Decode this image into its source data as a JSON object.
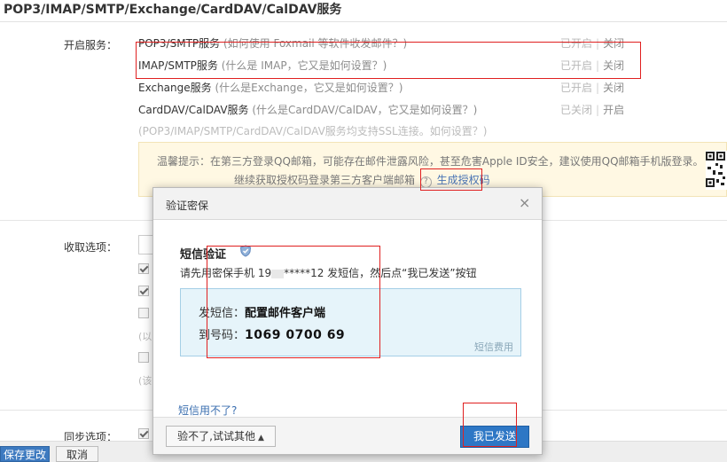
{
  "page": {
    "title": "POP3/IMAP/SMTP/Exchange/CardDAV/CalDAV服务"
  },
  "services": {
    "label": "开启服务：",
    "rows": [
      {
        "name": "POP3/SMTP服务",
        "hint": "(如何使用 Foxmail 等软件收发邮件？)",
        "status": "已开启",
        "action": "关闭"
      },
      {
        "name": "IMAP/SMTP服务",
        "hint": "(什么是 IMAP，它又是如何设置？)",
        "status": "已开启",
        "action": "关闭"
      },
      {
        "name": "Exchange服务",
        "hint": "(什么是Exchange，它又是如何设置？)",
        "status": "已开启",
        "action": "关闭"
      },
      {
        "name": "CardDAV/CalDAV服务",
        "hint": "(什么是CardDAV/CalDAV，它又是如何设置？)",
        "status": "已关闭",
        "action": "开启"
      }
    ],
    "separator": "|",
    "ssl_note": "(POP3/IMAP/SMTP/CardDAV/CalDAV服务均支持SSL连接。如何设置？)"
  },
  "tip": {
    "line1": "温馨提示：在第三方登录QQ邮箱，可能存在邮件泄露风险，甚至危害Apple ID安全，建议使用QQ邮箱手机版登录。",
    "line2": "继续获取授权码登录第三方客户端邮箱",
    "help": "?",
    "generate_code": "生成授权码"
  },
  "receive": {
    "label": "收取选项：",
    "paren1": "(以",
    "paren2": "(该"
  },
  "sync": {
    "label": "同步选项："
  },
  "footer": {
    "save": "保存更改",
    "cancel": "取消"
  },
  "dialog": {
    "title": "验证密保",
    "close": "×",
    "sms_title": "短信验证",
    "desc_prefix": "请先用密保手机 19",
    "desc_suffix": "*****12 发短信，然后点“我已发送”按钮",
    "send_label": "发短信：",
    "send_content": "配置邮件客户端",
    "to_label": "到号码：",
    "to_number": "1069 0700 69",
    "fee": "短信费用",
    "cant_use": "短信用不了?",
    "try_other": "验不了,试试其他",
    "try_other_caret": "▲",
    "sent_button": "我已发送"
  },
  "colors": {
    "accent": "#2e77c5",
    "highlight": "#e02020",
    "tip_bg": "#fff8e3",
    "info_bg": "#e6f4fa"
  }
}
